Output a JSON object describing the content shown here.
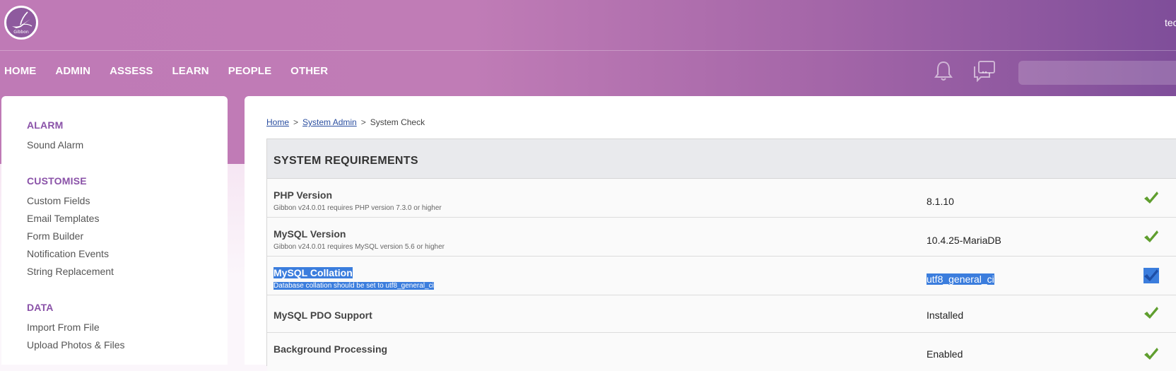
{
  "header": {
    "logo_text": "Gibbon",
    "username": "tec",
    "nav": [
      "HOME",
      "ADMIN",
      "ASSESS",
      "LEARN",
      "PEOPLE",
      "OTHER"
    ],
    "search_placeholder": ""
  },
  "sidebar": {
    "sections": [
      {
        "title": "ALARM",
        "items": [
          "Sound Alarm"
        ]
      },
      {
        "title": "CUSTOMISE",
        "items": [
          "Custom Fields",
          "Email Templates",
          "Form Builder",
          "Notification Events",
          "String Replacement"
        ]
      },
      {
        "title": "DATA",
        "items": [
          "Import From File",
          "Upload Photos & Files"
        ]
      }
    ]
  },
  "breadcrumb": {
    "home": "Home",
    "sep1": ">",
    "admin": "System Admin",
    "sep2": ">",
    "current": "System Check"
  },
  "table": {
    "title": "SYSTEM REQUIREMENTS",
    "rows": [
      {
        "name": "PHP Version",
        "desc": "Gibbon v24.0.01 requires PHP version 7.3.0 or higher",
        "value": "8.1.10"
      },
      {
        "name": "MySQL Version",
        "desc": "Gibbon v24.0.01 requires MySQL version 5.6 or higher",
        "value": "10.4.25-MariaDB"
      },
      {
        "name": "MySQL Collation",
        "desc": "Database collation should be set to utf8_general_ci",
        "value": "utf8_general_ci"
      },
      {
        "name": "MySQL PDO Support",
        "desc": "",
        "value": "Installed"
      },
      {
        "name": "Background Processing",
        "desc": "",
        "value": "Enabled"
      }
    ]
  },
  "colors": {
    "accent": "#8a52a8",
    "header_start": "#bf7ab6",
    "header_end": "#7f4e9a",
    "check": "#5f9e2e",
    "selection": "#3b7ddd"
  },
  "icons": {
    "notification": "bell-icon",
    "messages": "chat-icon",
    "status": "checkmark-icon"
  }
}
